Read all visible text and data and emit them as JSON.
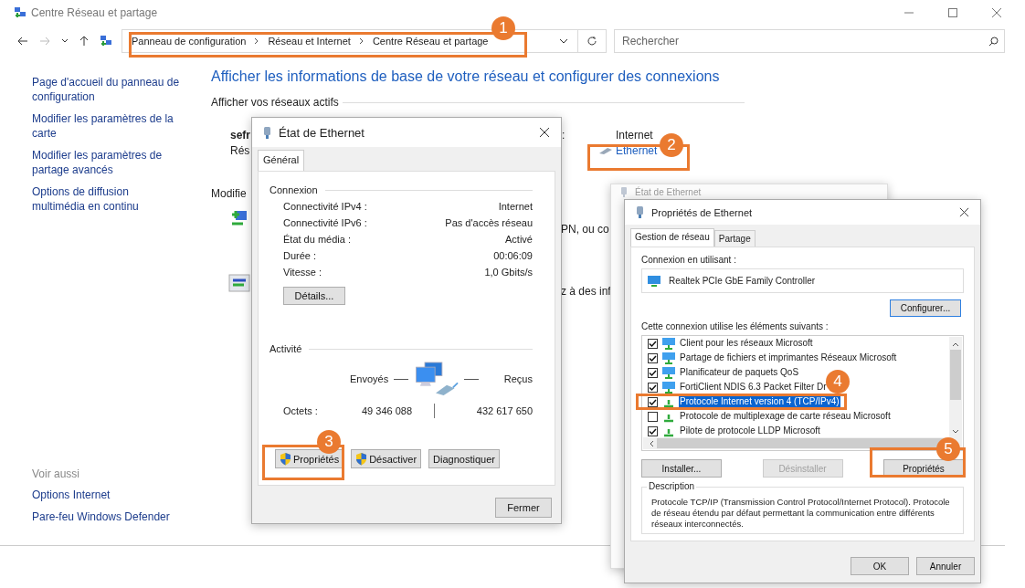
{
  "window": {
    "title": "Centre Réseau et partage"
  },
  "toolbar": {
    "breadcrumb": [
      "Panneau de configuration",
      "Réseau et Internet",
      "Centre Réseau et partage"
    ],
    "search": {
      "placeholder": "Rechercher"
    }
  },
  "sidebar": {
    "links": [
      "Page d'accueil du panneau de configuration",
      "Modifier les paramètres de la carte",
      "Modifier les paramètres de partage avancés",
      "Options de diffusion multimédia en continu"
    ],
    "see_also": {
      "title": "Voir aussi",
      "links": [
        "Options Internet",
        "Pare-feu Windows Defender"
      ]
    }
  },
  "main": {
    "heading": "Afficher les informations de base de votre réseau et configurer des connexions",
    "active_networks_title": "Afficher vos réseaux actifs",
    "network_name": "sefr",
    "network_type": "Rés",
    "colon": ":",
    "access_type": "Internet",
    "connection_link": "Ethernet",
    "change_title": "Modifie",
    "fragments": [
      "PN, ou co",
      "z à des inf"
    ]
  },
  "status_dialog": {
    "title": "État de Ethernet",
    "tabs": [
      {
        "label": "Général",
        "selected": true
      }
    ],
    "connection": {
      "title": "Connexion",
      "rows": [
        {
          "label": "Connectivité IPv4 :",
          "value": "Internet"
        },
        {
          "label": "Connectivité IPv6 :",
          "value": "Pas d'accès réseau"
        },
        {
          "label": "État du média :",
          "value": "Activé"
        },
        {
          "label": "Durée :",
          "value": "00:06:09"
        },
        {
          "label": "Vitesse :",
          "value": "1,0 Gbits/s"
        }
      ]
    },
    "details_button": "Détails...",
    "activity": {
      "title": "Activité",
      "sent_label": "Envoyés",
      "received_label": "Reçus",
      "bytes_label": "Octets :",
      "sent": "49 346 088",
      "received": "432 617 650"
    },
    "buttons": [
      {
        "label": "Propriétés",
        "shield": true
      },
      {
        "label": "Désactiver",
        "shield": true
      },
      {
        "label": "Diagnostiquer",
        "shield": false
      }
    ],
    "close_button": "Fermer"
  },
  "background_dialog": {
    "title": "État de Ethernet"
  },
  "properties_dialog": {
    "title": "Propriétés de Ethernet",
    "tabs": [
      {
        "label": "Gestion de réseau",
        "selected": true
      },
      {
        "label": "Partage",
        "selected": false
      }
    ],
    "connect_using_label": "Connexion en utilisant :",
    "adapter": "Realtek PCIe GbE Family Controller",
    "configure_button": "Configurer...",
    "items_label": "Cette connexion utilise les éléments suivants :",
    "items": [
      {
        "label": "Client pour les réseaux Microsoft",
        "kind": "service",
        "checked": true,
        "selected": false
      },
      {
        "label": "Partage de fichiers et imprimantes Réseaux Microsoft",
        "kind": "service",
        "checked": true,
        "selected": false
      },
      {
        "label": "Planificateur de paquets QoS",
        "kind": "service",
        "checked": true,
        "selected": false
      },
      {
        "label": "FortiClient NDIS 6.3 Packet Filter Dr",
        "kind": "service",
        "checked": true,
        "selected": false
      },
      {
        "label": "Protocole Internet version 4 (TCP/IPv4)",
        "kind": "protocol",
        "checked": true,
        "selected": true
      },
      {
        "label": "Protocole de multiplexage de carte réseau Microsoft",
        "kind": "protocol",
        "checked": false,
        "selected": false
      },
      {
        "label": "Pilote de protocole LLDP Microsoft",
        "kind": "protocol",
        "checked": true,
        "selected": false
      }
    ],
    "buttons": [
      {
        "label": "Installer...",
        "disabled": false
      },
      {
        "label": "Désinstaller",
        "disabled": true
      },
      {
        "label": "Propriétés",
        "disabled": false
      }
    ],
    "description": {
      "title": "Description",
      "text": "Protocole TCP/IP (Transmission Control Protocol/Internet Protocol). Protocole de réseau étendu par défaut permettant la communication entre différents réseaux interconnectés."
    },
    "ok_button": "OK",
    "cancel_button": "Annuler"
  },
  "annotations": [
    {
      "number": "1"
    },
    {
      "number": "2"
    },
    {
      "number": "3"
    },
    {
      "number": "4"
    },
    {
      "number": "5"
    }
  ]
}
